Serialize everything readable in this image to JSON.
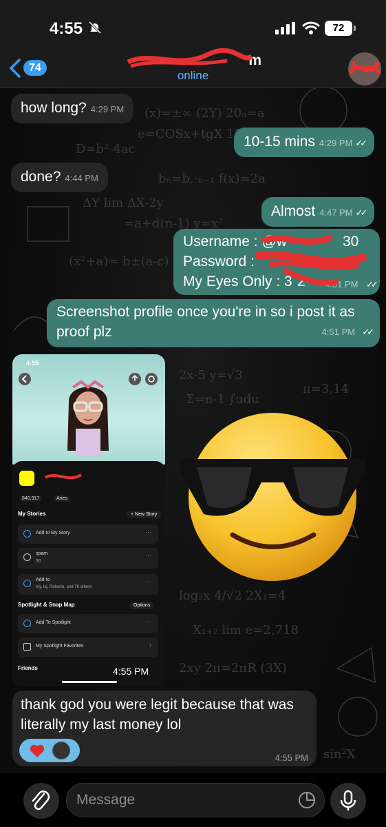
{
  "status_bar": {
    "time": "4:55",
    "battery": "72"
  },
  "header": {
    "unread_count": "74",
    "contact_name": "m",
    "contact_status": "online"
  },
  "messages": [
    {
      "direction": "in",
      "text": "how long?",
      "time": "4:29 PM"
    },
    {
      "direction": "out",
      "text": "10-15 mins",
      "time": "4:29 PM"
    },
    {
      "direction": "in",
      "text": "done?",
      "time": "4:44 PM"
    },
    {
      "direction": "out",
      "text": "Almost",
      "time": "4:47 PM"
    },
    {
      "direction": "out",
      "lines": [
        "Username : @w",
        "Password :",
        "My Eyes Only : 3"
      ],
      "line_tails": [
        "30",
        "",
        "2"
      ],
      "time": "4:51 PM"
    },
    {
      "direction": "out",
      "text": "Screenshot profile once you're in so i post it as proof plz",
      "time": "4:51 PM"
    },
    {
      "direction": "in",
      "type": "image",
      "time": "4:55 PM"
    },
    {
      "direction": "in",
      "text": "thank god you were legit because that was literally my last money lol",
      "time": "4:55 PM"
    }
  ],
  "screenshot": {
    "time": "4:55",
    "score": "840,917",
    "zodiac": "Aries",
    "my_stories": "My Stories",
    "new_story": "+ New Story",
    "add_to_my_story": "Add to My Story",
    "spam_story": "spam",
    "spam_views": "50",
    "add_to_group": "Add to",
    "group_members": "my, lsj, Roberto, and 76 others",
    "spotlight_header": "Spotlight & Snap Map",
    "options": "Options",
    "add_to_spotlight": "Add To Spotlight",
    "spotlight_favorites": "My Spotlight Favorites",
    "friends": "Friends"
  },
  "input": {
    "placeholder": "Message"
  },
  "colors": {
    "outgoing": "#3d7c72",
    "incoming": "#262626",
    "accent": "#3b9cf0",
    "redaction": "#e63232"
  },
  "icons": [
    "bell-off-icon",
    "signal-icon",
    "wifi-icon",
    "back-chevron-icon",
    "heart-icon",
    "paperclip-icon",
    "sticker-icon",
    "microphone-icon",
    "double-check-icon"
  ]
}
